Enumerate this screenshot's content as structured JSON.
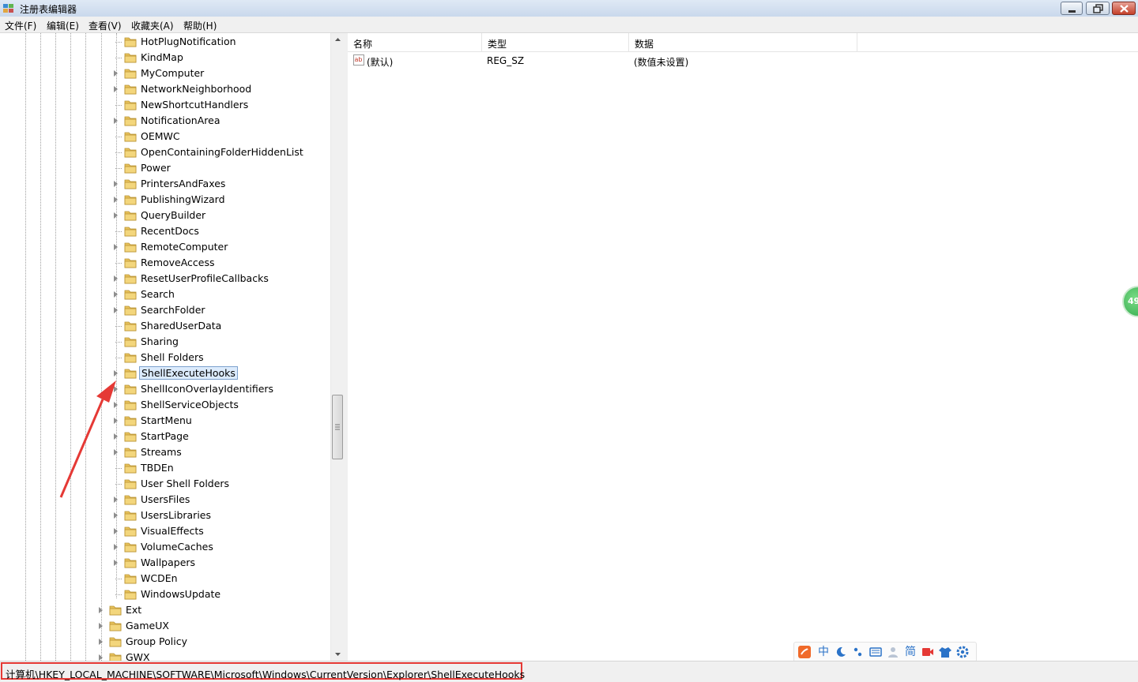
{
  "window": {
    "title": "注册表编辑器"
  },
  "menu": [
    {
      "label": "文件(F)"
    },
    {
      "label": "编辑(E)"
    },
    {
      "label": "查看(V)"
    },
    {
      "label": "收藏夹(A)"
    },
    {
      "label": "帮助(H)"
    }
  ],
  "tree": {
    "children": [
      {
        "label": "HotPlugNotification",
        "expandable": false
      },
      {
        "label": "KindMap",
        "expandable": false
      },
      {
        "label": "MyComputer",
        "expandable": true
      },
      {
        "label": "NetworkNeighborhood",
        "expandable": true
      },
      {
        "label": "NewShortcutHandlers",
        "expandable": false
      },
      {
        "label": "NotificationArea",
        "expandable": true
      },
      {
        "label": "OEMWC",
        "expandable": false
      },
      {
        "label": "OpenContainingFolderHiddenList",
        "expandable": false
      },
      {
        "label": "Power",
        "expandable": false
      },
      {
        "label": "PrintersAndFaxes",
        "expandable": true
      },
      {
        "label": "PublishingWizard",
        "expandable": true
      },
      {
        "label": "QueryBuilder",
        "expandable": true
      },
      {
        "label": "RecentDocs",
        "expandable": false
      },
      {
        "label": "RemoteComputer",
        "expandable": true
      },
      {
        "label": "RemoveAccess",
        "expandable": false
      },
      {
        "label": "ResetUserProfileCallbacks",
        "expandable": true
      },
      {
        "label": "Search",
        "expandable": true
      },
      {
        "label": "SearchFolder",
        "expandable": true
      },
      {
        "label": "SharedUserData",
        "expandable": false
      },
      {
        "label": "Sharing",
        "expandable": false
      },
      {
        "label": "Shell Folders",
        "expandable": false
      },
      {
        "label": "ShellExecuteHooks",
        "expandable": true,
        "selected": true
      },
      {
        "label": "ShellIconOverlayIdentifiers",
        "expandable": true
      },
      {
        "label": "ShellServiceObjects",
        "expandable": true
      },
      {
        "label": "StartMenu",
        "expandable": true
      },
      {
        "label": "StartPage",
        "expandable": true
      },
      {
        "label": "Streams",
        "expandable": true
      },
      {
        "label": "TBDEn",
        "expandable": false
      },
      {
        "label": "User Shell Folders",
        "expandable": false
      },
      {
        "label": "UsersFiles",
        "expandable": true
      },
      {
        "label": "UsersLibraries",
        "expandable": true
      },
      {
        "label": "VisualEffects",
        "expandable": true
      },
      {
        "label": "VolumeCaches",
        "expandable": true
      },
      {
        "label": "Wallpapers",
        "expandable": true
      },
      {
        "label": "WCDEn",
        "expandable": false
      },
      {
        "label": "WindowsUpdate",
        "expandable": false
      }
    ],
    "siblings": [
      {
        "label": "Ext",
        "expandable": true
      },
      {
        "label": "GameUX",
        "expandable": true
      },
      {
        "label": "Group Policy",
        "expandable": true
      },
      {
        "label": "GWX",
        "expandable": true
      }
    ]
  },
  "values_table": {
    "columns": [
      "名称",
      "类型",
      "数据"
    ],
    "rows": [
      {
        "name": "(默认)",
        "type": "REG_SZ",
        "data": "(数值未设置)",
        "icon": "string-value-icon"
      }
    ]
  },
  "status": {
    "path": "计算机\\HKEY_LOCAL_MACHINE\\SOFTWARE\\Microsoft\\Windows\\CurrentVersion\\Explorer\\ShellExecuteHooks"
  },
  "floating_badge": {
    "text": "49"
  },
  "ime_toolbar": {
    "items": [
      "sogou-logo-icon",
      "中",
      "moon-icon",
      "punctuation-icon",
      "keyboard-icon",
      "user-icon",
      "简",
      "video-icon",
      "skin-icon",
      "settings-icon"
    ]
  },
  "colors": {
    "annotation": "#e53935",
    "selection": "#dcebfc",
    "folder": "#e8c25c"
  }
}
